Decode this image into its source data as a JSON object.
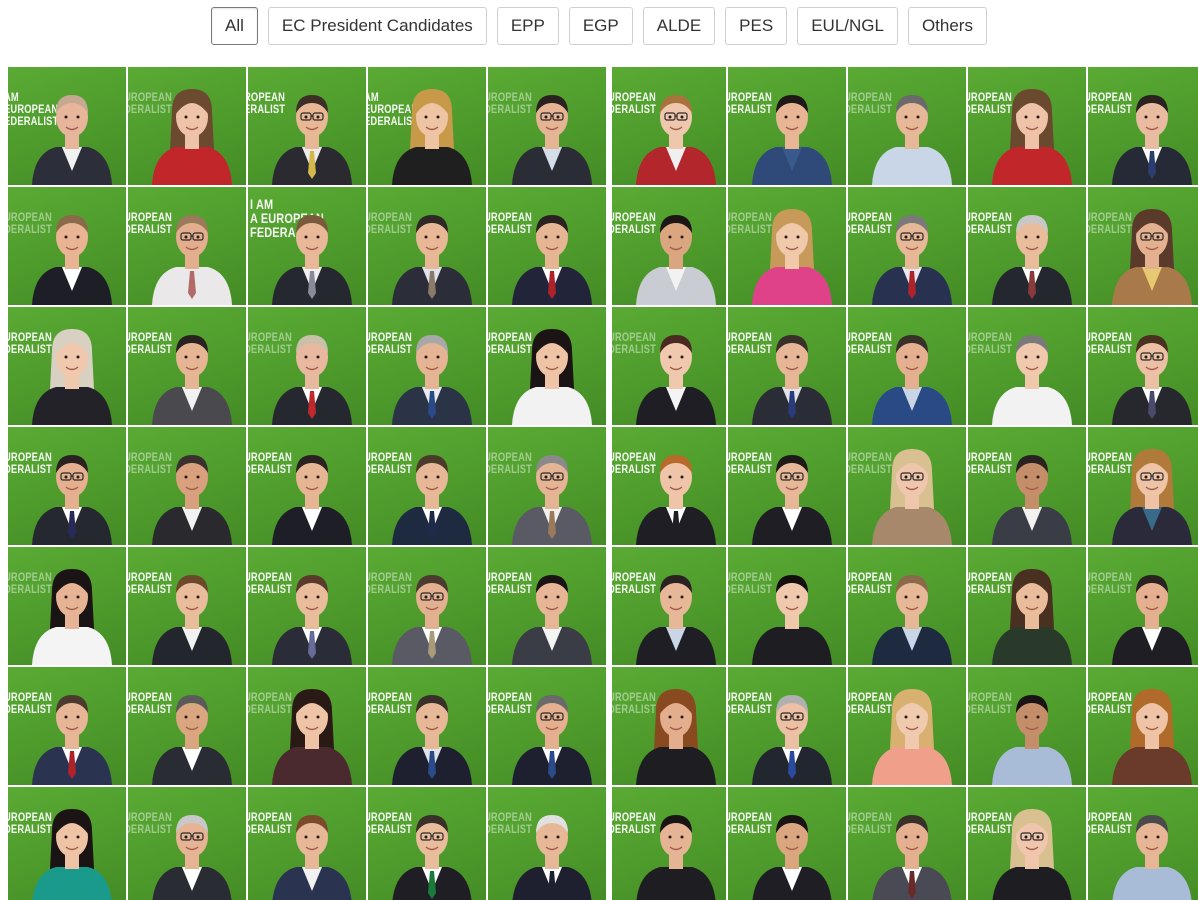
{
  "filters": [
    {
      "label": "All",
      "active": true
    },
    {
      "label": "EC President Candidates",
      "active": false
    },
    {
      "label": "EPP",
      "active": false
    },
    {
      "label": "EGP",
      "active": false
    },
    {
      "label": "ALDE",
      "active": false
    },
    {
      "label": "PES",
      "active": false
    },
    {
      "label": "EUL/NGL",
      "active": false
    },
    {
      "label": "Others",
      "active": false
    }
  ],
  "tile_text_variants": {
    "full": "I AM\nA EUROPEAN\nFEDERALIST",
    "am": "AM\nEUROPEAN\nEDERALIST",
    "cropped": "UROPEAN\nDERALIST",
    "cropped_more": "ROPEAN\nERALIST"
  },
  "colors": {
    "tile_green": "#4e9b2c",
    "skin": "#e6b89a",
    "hair_dark": "#2b2220",
    "suit": "#2e3240"
  },
  "grid": {
    "rows": [
      [
        {
          "text": "am",
          "skin": "#e7b59c",
          "hair": "#c7a890",
          "suit": "#2c2f3a",
          "shirt": "#f2f2f2",
          "tie": null,
          "glasses": false,
          "long_hair": false
        },
        {
          "text": "cropped",
          "skin": "#efc3a8",
          "hair": "#6b4a30",
          "suit": "#c1262b",
          "shirt": "#c1262b",
          "tie": null,
          "glasses": false,
          "long_hair": true
        },
        {
          "text": "cropped_more",
          "skin": "#e8b896",
          "hair": "#3b2f28",
          "suit": "#2a2a30",
          "shirt": "#ececec",
          "tie": "#d4b84a",
          "glasses": true,
          "long_hair": false
        },
        {
          "text": "am",
          "skin": "#efc4a3",
          "hair": "#c79a4a",
          "suit": "#1f1f1f",
          "shirt": "#1f1f1f",
          "tie": null,
          "glasses": false,
          "long_hair": true
        },
        {
          "text": "cropped",
          "skin": "#e4b494",
          "hair": "#2a2220",
          "suit": "#2a2c36",
          "shirt": "#d5dde8",
          "tie": null,
          "glasses": true,
          "long_hair": false
        },
        {
          "text": "cropped",
          "skin": "#efc7ad",
          "hair": "#a8743e",
          "suit": "#b3262b",
          "shirt": "#f0f0f0",
          "tie": null,
          "glasses": true,
          "long_hair": false
        },
        {
          "text": "cropped",
          "skin": "#e8b694",
          "hair": "#1f1a18",
          "suit": "#2f4a78",
          "shirt": "#3a5a8c",
          "tie": null,
          "glasses": false,
          "long_hair": false
        },
        {
          "text": "cropped",
          "skin": "#e7b898",
          "hair": "#6a6a6a",
          "suit": "#c9d6e8",
          "shirt": "#c9d6e8",
          "tie": null,
          "glasses": false,
          "long_hair": false
        },
        {
          "text": "cropped",
          "skin": "#efc3a8",
          "hair": "#6a4a2e",
          "suit": "#c1262b",
          "shirt": "#c1262b",
          "tie": null,
          "glasses": false,
          "long_hair": true
        },
        {
          "text": "cropped",
          "skin": "#e9bba0",
          "hair": "#2a2220",
          "suit": "#262a36",
          "shirt": "#ffffff",
          "tie": "#2c3e70",
          "glasses": false,
          "long_hair": false
        }
      ],
      [
        {
          "text": "cropped",
          "skin": "#e8b494",
          "hair": "#8a6a4a",
          "suit": "#1e1f26",
          "shirt": "#ffffff",
          "tie": null,
          "glasses": false,
          "long_hair": false
        },
        {
          "text": "cropped",
          "skin": "#e3ae8e",
          "hair": "#9a7a5a",
          "suit": "#eae8e8",
          "shirt": "#eae8e8",
          "tie": "#b36a6a",
          "glasses": true,
          "long_hair": false
        },
        {
          "text": "full",
          "skin": "#e8b898",
          "hair": "#7a5a3a",
          "suit": "#262830",
          "shirt": "#f0f0f0",
          "tie": "#8a8a9a",
          "glasses": false,
          "long_hair": false
        },
        {
          "text": "cropped",
          "skin": "#e7b796",
          "hair": "#2e2826",
          "suit": "#2b2d38",
          "shirt": "#dfe4ec",
          "tie": "#8a7a6a",
          "glasses": false,
          "long_hair": false
        },
        {
          "text": "cropped",
          "skin": "#e6b594",
          "hair": "#2a2220",
          "suit": "#22253a",
          "shirt": "#ffffff",
          "tie": "#b0222a",
          "glasses": false,
          "long_hair": false
        },
        {
          "text": "cropped",
          "skin": "#d9a680",
          "hair": "#1c1614",
          "suit": "#c9ccd2",
          "shirt": "#f2f2f2",
          "tie": null,
          "glasses": false,
          "long_hair": false
        },
        {
          "text": "cropped",
          "skin": "#f0c8aa",
          "hair": "#c89a5a",
          "suit": "#e0428a",
          "shirt": "#e0428a",
          "tie": null,
          "glasses": false,
          "long_hair": true
        },
        {
          "text": "cropped",
          "skin": "#e7b898",
          "hair": "#7a7a7a",
          "suit": "#283250",
          "shirt": "#e8e8f0",
          "tie": "#b0222a",
          "glasses": true,
          "long_hair": false
        },
        {
          "text": "cropped",
          "skin": "#e9bc9c",
          "hair": "#c8c8c8",
          "suit": "#25272e",
          "shirt": "#ffffff",
          "tie": "#8a3a3a",
          "glasses": false,
          "long_hair": false
        },
        {
          "text": "cropped",
          "skin": "#e3b090",
          "hair": "#5a3a2a",
          "suit": "#a87a4a",
          "shirt": "#e8c870",
          "tie": null,
          "glasses": true,
          "long_hair": true
        }
      ],
      [
        {
          "text": "cropped",
          "skin": "#efc8ae",
          "hair": "#d8d0c0",
          "suit": "#222228",
          "shirt": "#222228",
          "tie": null,
          "glasses": false,
          "long_hair": true
        },
        {
          "text": "cropped",
          "skin": "#e5b594",
          "hair": "#2a2220",
          "suit": "#4a4a4e",
          "shirt": "#f2f2f2",
          "tie": null,
          "glasses": false,
          "long_hair": false
        },
        {
          "text": "cropped",
          "skin": "#e9b8a0",
          "hair": "#c8c0a8",
          "suit": "#262830",
          "shirt": "#ffffff",
          "tie": "#c0282e",
          "glasses": false,
          "long_hair": false
        },
        {
          "text": "cropped",
          "skin": "#e5b494",
          "hair": "#a8a8a8",
          "suit": "#2a3446",
          "shirt": "#e8ecf2",
          "tie": "#2a4a8a",
          "glasses": false,
          "long_hair": false
        },
        {
          "text": "cropped",
          "skin": "#efc4a6",
          "hair": "#1a1414",
          "suit": "#f2f2f2",
          "shirt": "#f2f2f2",
          "tie": null,
          "glasses": false,
          "long_hair": true
        },
        {
          "text": "cropped",
          "skin": "#efc8ae",
          "hair": "#4a2a20",
          "suit": "#1e1e24",
          "shirt": "#f4f4f4",
          "tie": null,
          "glasses": false,
          "long_hair": false
        },
        {
          "text": "cropped",
          "skin": "#e6b696",
          "hair": "#3a302a",
          "suit": "#2a2c36",
          "shirt": "#dfe4ec",
          "tie": "#2a3a7a",
          "glasses": false,
          "long_hair": false
        },
        {
          "text": "cropped",
          "skin": "#e4b090",
          "hair": "#3a302a",
          "suit": "#2a4a86",
          "shirt": "#c9d6e8",
          "tie": null,
          "glasses": false,
          "long_hair": false
        },
        {
          "text": "cropped",
          "skin": "#efc8ae",
          "hair": "#7a7a7a",
          "suit": "#f2f2f2",
          "shirt": "#f2f2f2",
          "tie": null,
          "glasses": false,
          "long_hair": false
        },
        {
          "text": "cropped",
          "skin": "#ecc0a4",
          "hair": "#4a3020",
          "suit": "#26282e",
          "shirt": "#ffffff",
          "tie": "#4a4a6a",
          "glasses": true,
          "long_hair": false
        }
      ],
      [
        {
          "text": "cropped",
          "skin": "#e4b090",
          "hair": "#2a2220",
          "suit": "#262830",
          "shirt": "#ffffff",
          "tie": "#2a2a5a",
          "glasses": true,
          "long_hair": false
        },
        {
          "text": "cropped",
          "skin": "#d9a07e",
          "hair": "#3a3030",
          "suit": "#2a2a2e",
          "shirt": "#f2f2f2",
          "tie": null,
          "glasses": false,
          "long_hair": false
        },
        {
          "text": "cropped",
          "skin": "#e6b594",
          "hair": "#2a2220",
          "suit": "#1e1f26",
          "shirt": "#ffffff",
          "tie": null,
          "glasses": false,
          "long_hair": false
        },
        {
          "text": "cropped",
          "skin": "#e7b898",
          "hair": "#4a3a2a",
          "suit": "#1e2a40",
          "shirt": "#ffffff",
          "tie": "#1e2a4a",
          "glasses": false,
          "long_hair": false
        },
        {
          "text": "cropped",
          "skin": "#e5b494",
          "hair": "#8a8a8a",
          "suit": "#5a5a64",
          "shirt": "#f0f0f0",
          "tie": "#9a7a5a",
          "glasses": true,
          "long_hair": false
        },
        {
          "text": "cropped",
          "skin": "#efc4a8",
          "hair": "#b86a2a",
          "suit": "#1e1e24",
          "shirt": "#ffffff",
          "tie": "#1e1e24",
          "glasses": false,
          "long_hair": false
        },
        {
          "text": "cropped",
          "skin": "#e7b898",
          "hair": "#1e1a18",
          "suit": "#1e1e24",
          "shirt": "#ffffff",
          "tie": null,
          "glasses": true,
          "long_hair": false
        },
        {
          "text": "cropped",
          "skin": "#efc6ac",
          "hair": "#d8c090",
          "suit": "#a8886a",
          "shirt": "#a8886a",
          "tie": null,
          "glasses": true,
          "long_hair": true
        },
        {
          "text": "cropped",
          "skin": "#c48e6a",
          "hair": "#2a2220",
          "suit": "#3a3c46",
          "shirt": "#f2f2f2",
          "tie": null,
          "glasses": false,
          "long_hair": false
        },
        {
          "text": "cropped",
          "skin": "#efc4a6",
          "hair": "#b07a3a",
          "suit": "#2a2a3a",
          "shirt": "#3a6a8a",
          "tie": null,
          "glasses": true,
          "long_hair": true
        }
      ],
      [
        {
          "text": "cropped",
          "skin": "#e6b494",
          "hair": "#1a1414",
          "suit": "#f4f4f4",
          "shirt": "#f4f4f4",
          "tie": null,
          "glasses": false,
          "long_hair": true
        },
        {
          "text": "cropped",
          "skin": "#e9bc9c",
          "hair": "#6a4a2a",
          "suit": "#24262e",
          "shirt": "#f2f2f2",
          "tie": null,
          "glasses": false,
          "long_hair": false
        },
        {
          "text": "cropped",
          "skin": "#e9bc9c",
          "hair": "#5a3a2a",
          "suit": "#2a2c38",
          "shirt": "#ffffff",
          "tie": "#6a6a9a",
          "glasses": false,
          "long_hair": false
        },
        {
          "text": "cropped",
          "skin": "#e3b090",
          "hair": "#4a3a30",
          "suit": "#5a5a64",
          "shirt": "#ffffff",
          "tie": "#a89a7a",
          "glasses": true,
          "long_hair": false
        },
        {
          "text": "cropped",
          "skin": "#e6b696",
          "hair": "#1a1414",
          "suit": "#3a3c46",
          "shirt": "#f4f4f4",
          "tie": null,
          "glasses": false,
          "long_hair": false
        },
        {
          "text": "cropped",
          "skin": "#e7b898",
          "hair": "#2a2220",
          "suit": "#1e1e24",
          "shirt": "#c9d6e8",
          "tie": null,
          "glasses": false,
          "long_hair": false
        },
        {
          "text": "cropped",
          "skin": "#efc8ae",
          "hair": "#141010",
          "suit": "#1e1e22",
          "shirt": "#1e1e22",
          "tie": null,
          "glasses": false,
          "long_hair": false
        },
        {
          "text": "cropped",
          "skin": "#e7b898",
          "hair": "#8a6a4a",
          "suit": "#1e2a40",
          "shirt": "#c9d6e8",
          "tie": null,
          "glasses": false,
          "long_hair": false
        },
        {
          "text": "cropped",
          "skin": "#e9bc9c",
          "hair": "#4a3020",
          "suit": "#2a3a2a",
          "shirt": "#2a3a2a",
          "tie": null,
          "glasses": false,
          "long_hair": true
        },
        {
          "text": "cropped",
          "skin": "#e4b090",
          "hair": "#2a2220",
          "suit": "#1e1e24",
          "shirt": "#ffffff",
          "tie": null,
          "glasses": false,
          "long_hair": false
        }
      ],
      [
        {
          "text": "cropped",
          "skin": "#e6b696",
          "hair": "#4a3a30",
          "suit": "#2a3450",
          "shirt": "#ffffff",
          "tie": "#b0222a",
          "glasses": false,
          "long_hair": false
        },
        {
          "text": "cropped",
          "skin": "#d9a680",
          "hair": "#5a5a5a",
          "suit": "#2a2c34",
          "shirt": "#ffffff",
          "tie": null,
          "glasses": false,
          "long_hair": false
        },
        {
          "text": "cropped",
          "skin": "#efc4a6",
          "hair": "#2a1a16",
          "suit": "#4a2a2e",
          "shirt": "#4a2a2e",
          "tie": null,
          "glasses": false,
          "long_hair": true
        },
        {
          "text": "cropped",
          "skin": "#e7b898",
          "hair": "#3a302a",
          "suit": "#1e2030",
          "shirt": "#dfe4ec",
          "tie": "#2a4a8a",
          "glasses": false,
          "long_hair": false
        },
        {
          "text": "cropped",
          "skin": "#e4b090",
          "hair": "#6a6a6a",
          "suit": "#1e2030",
          "shirt": "#ffffff",
          "tie": "#2a4a8a",
          "glasses": true,
          "long_hair": false
        },
        {
          "text": "cropped",
          "skin": "#e3ae8e",
          "hair": "#8a4a20",
          "suit": "#1e1e22",
          "shirt": "#1e1e22",
          "tie": null,
          "glasses": false,
          "long_hair": true
        },
        {
          "text": "cropped",
          "skin": "#ecc0a4",
          "hair": "#b0b0b0",
          "suit": "#22262e",
          "shirt": "#ffffff",
          "tie": "#2a4aa0",
          "glasses": true,
          "long_hair": false
        },
        {
          "text": "cropped",
          "skin": "#f0caae",
          "hair": "#d8b070",
          "suit": "#f0a08a",
          "shirt": "#f0a08a",
          "tie": null,
          "glasses": false,
          "long_hair": true
        },
        {
          "text": "cropped",
          "skin": "#c48e6a",
          "hair": "#1a1414",
          "suit": "#a8bcd8",
          "shirt": "#a8bcd8",
          "tie": null,
          "glasses": false,
          "long_hair": false
        },
        {
          "text": "cropped",
          "skin": "#efc4a6",
          "hair": "#b06a2a",
          "suit": "#6a3a2a",
          "shirt": "#6a3a2a",
          "tie": null,
          "glasses": false,
          "long_hair": true
        }
      ],
      [
        {
          "text": "cropped",
          "skin": "#efc4a6",
          "hair": "#1a1414",
          "suit": "#1a9a8a",
          "shirt": "#1a9a8a",
          "tie": null,
          "glasses": false,
          "long_hair": true
        },
        {
          "text": "cropped",
          "skin": "#e6b494",
          "hair": "#c8c8c8",
          "suit": "#2a2c34",
          "shirt": "#ffffff",
          "tie": null,
          "glasses": true,
          "long_hair": false
        },
        {
          "text": "cropped",
          "skin": "#e7b898",
          "hair": "#7a4a2a",
          "suit": "#2a3450",
          "shirt": "#f2f2f2",
          "tie": null,
          "glasses": false,
          "long_hair": false
        },
        {
          "text": "cropped",
          "skin": "#e9bc9c",
          "hair": "#3a302a",
          "suit": "#1e1e24",
          "shirt": "#ffffff",
          "tie": "#1a7a3a",
          "glasses": true,
          "long_hair": false
        },
        {
          "text": "cropped",
          "skin": "#e7b898",
          "hair": "#e0e0e0",
          "suit": "#1e2030",
          "shirt": "#ffffff",
          "tie": "#1e2030",
          "glasses": false,
          "long_hair": false
        },
        {
          "text": "cropped",
          "skin": "#e5b494",
          "hair": "#1a1414",
          "suit": "#1e1e22",
          "shirt": "#1e1e22",
          "tie": null,
          "glasses": false,
          "long_hair": false
        },
        {
          "text": "cropped",
          "skin": "#d9a680",
          "hair": "#1a1414",
          "suit": "#1e1e24",
          "shirt": "#ffffff",
          "tie": null,
          "glasses": false,
          "long_hair": false
        },
        {
          "text": "cropped",
          "skin": "#e4b090",
          "hair": "#3a302a",
          "suit": "#4a4a54",
          "shirt": "#ffffff",
          "tie": "#6a2a2a",
          "glasses": false,
          "long_hair": false
        },
        {
          "text": "cropped",
          "skin": "#efc6ac",
          "hair": "#d8c090",
          "suit": "#1e1e22",
          "shirt": "#1e1e22",
          "tie": null,
          "glasses": true,
          "long_hair": true
        },
        {
          "text": "cropped",
          "skin": "#e6b696",
          "hair": "#4a4a4a",
          "suit": "#a8bcd8",
          "shirt": "#a8bcd8",
          "tie": null,
          "glasses": false,
          "long_hair": false
        }
      ]
    ]
  }
}
